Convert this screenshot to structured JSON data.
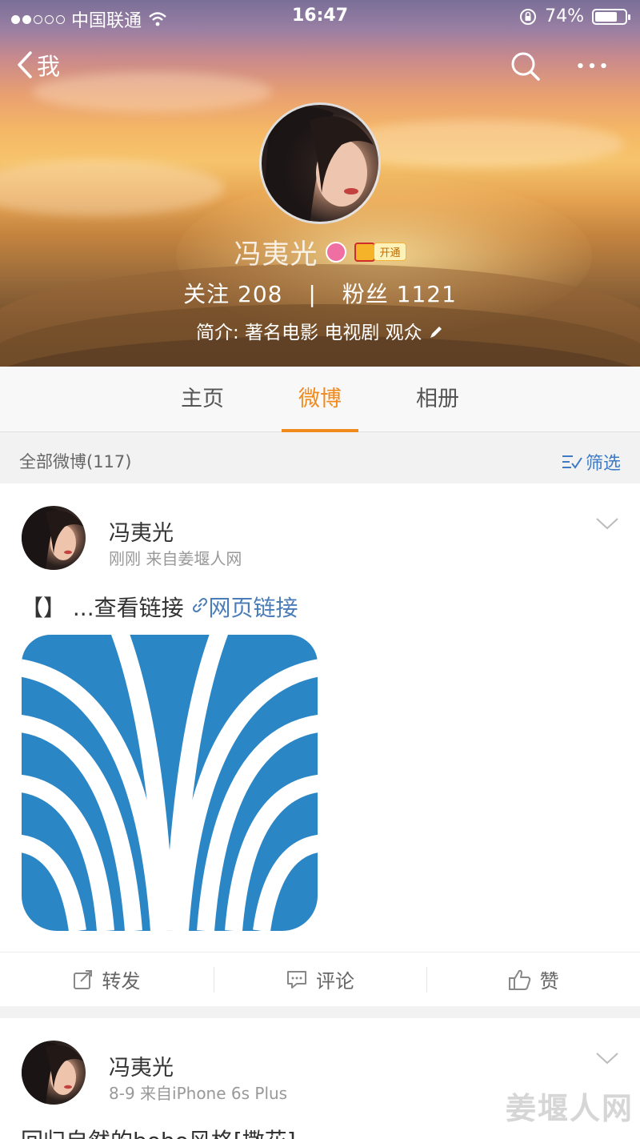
{
  "status_bar": {
    "carrier": "中国联通",
    "time": "16:47",
    "battery": "74%",
    "battery_level": 0.74
  },
  "nav": {
    "back_label": "我",
    "search_icon": "search-icon",
    "more_icon": "more-icon"
  },
  "profile": {
    "name": "冯夷光",
    "vip_tag": "开通",
    "follow_label": "关注",
    "follow_count": "208",
    "separator": "|",
    "fans_label": "粉丝",
    "fans_count": "1121",
    "bio": "简介: 著名电影 电视剧 观众"
  },
  "tabs": [
    {
      "label": "主页",
      "active": false
    },
    {
      "label": "微博",
      "active": true
    },
    {
      "label": "相册",
      "active": false
    }
  ],
  "filterbar": {
    "count_label": "全部微博(117)",
    "filter_label": "筛选"
  },
  "posts": [
    {
      "author": "冯夷光",
      "meta": "刚刚  来自姜堰人网",
      "text_prefix": "【】 ...查看链接",
      "link_text": "网页链接",
      "actions": {
        "repost": "转发",
        "comment": "评论",
        "like": "赞"
      }
    },
    {
      "author": "冯夷光",
      "meta": "8-9  来自iPhone 6s Plus",
      "text_prefix": "回归自然的boho风格[撒花]"
    }
  ],
  "watermark": "姜堰人网",
  "colors": {
    "accent_orange": "#f08a1d",
    "link_blue": "#4a7db8",
    "logo_blue": "#2b86c5"
  }
}
